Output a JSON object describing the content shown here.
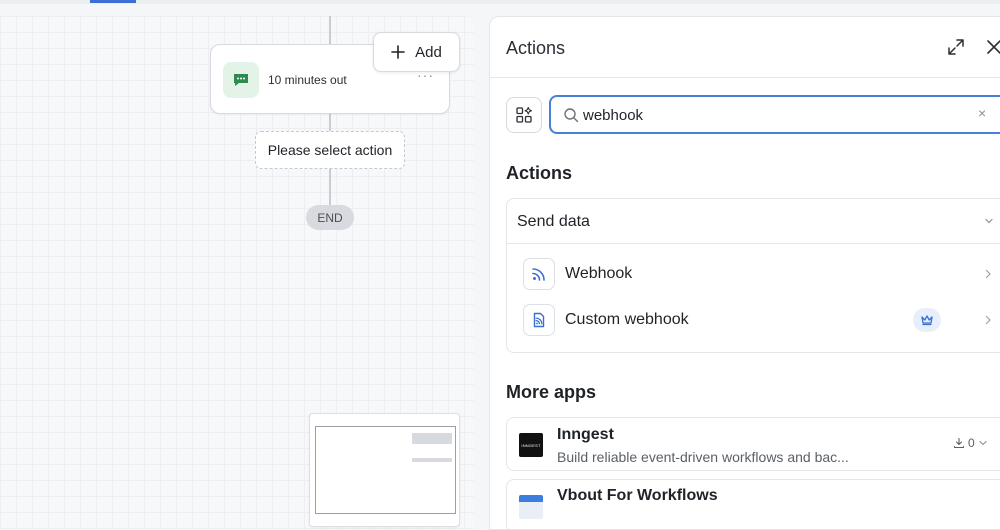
{
  "canvas": {
    "trigger_node": {
      "label": "10 minutes out",
      "more": "···"
    },
    "add_button": {
      "label": "Add"
    },
    "placeholder_node": {
      "label": "Please select action"
    },
    "end_node": {
      "label": "END"
    }
  },
  "panel": {
    "title": "Actions",
    "search": {
      "value": "webhook",
      "clear": "×"
    },
    "actions_section_title": "Actions",
    "group": {
      "title": "Send data",
      "items": [
        {
          "label": "Webhook",
          "icon": "webhook-icon",
          "premium": false
        },
        {
          "label": "Custom webhook",
          "icon": "custom-webhook-icon",
          "premium": true
        }
      ]
    },
    "more_apps_title": "More apps",
    "apps": [
      {
        "name": "Inngest",
        "logo_text": "INNGEST",
        "description": "Build reliable event-driven workflows and bac...",
        "downloads": "0"
      },
      {
        "name": "Vbout For Workflows",
        "description": "",
        "downloads": ""
      }
    ]
  },
  "colors": {
    "accent": "#4a7fd6",
    "node_icon_bg": "#e3f3e8",
    "node_icon_fg": "#2e8a4f",
    "premium_badge": "#3b6fd4"
  }
}
